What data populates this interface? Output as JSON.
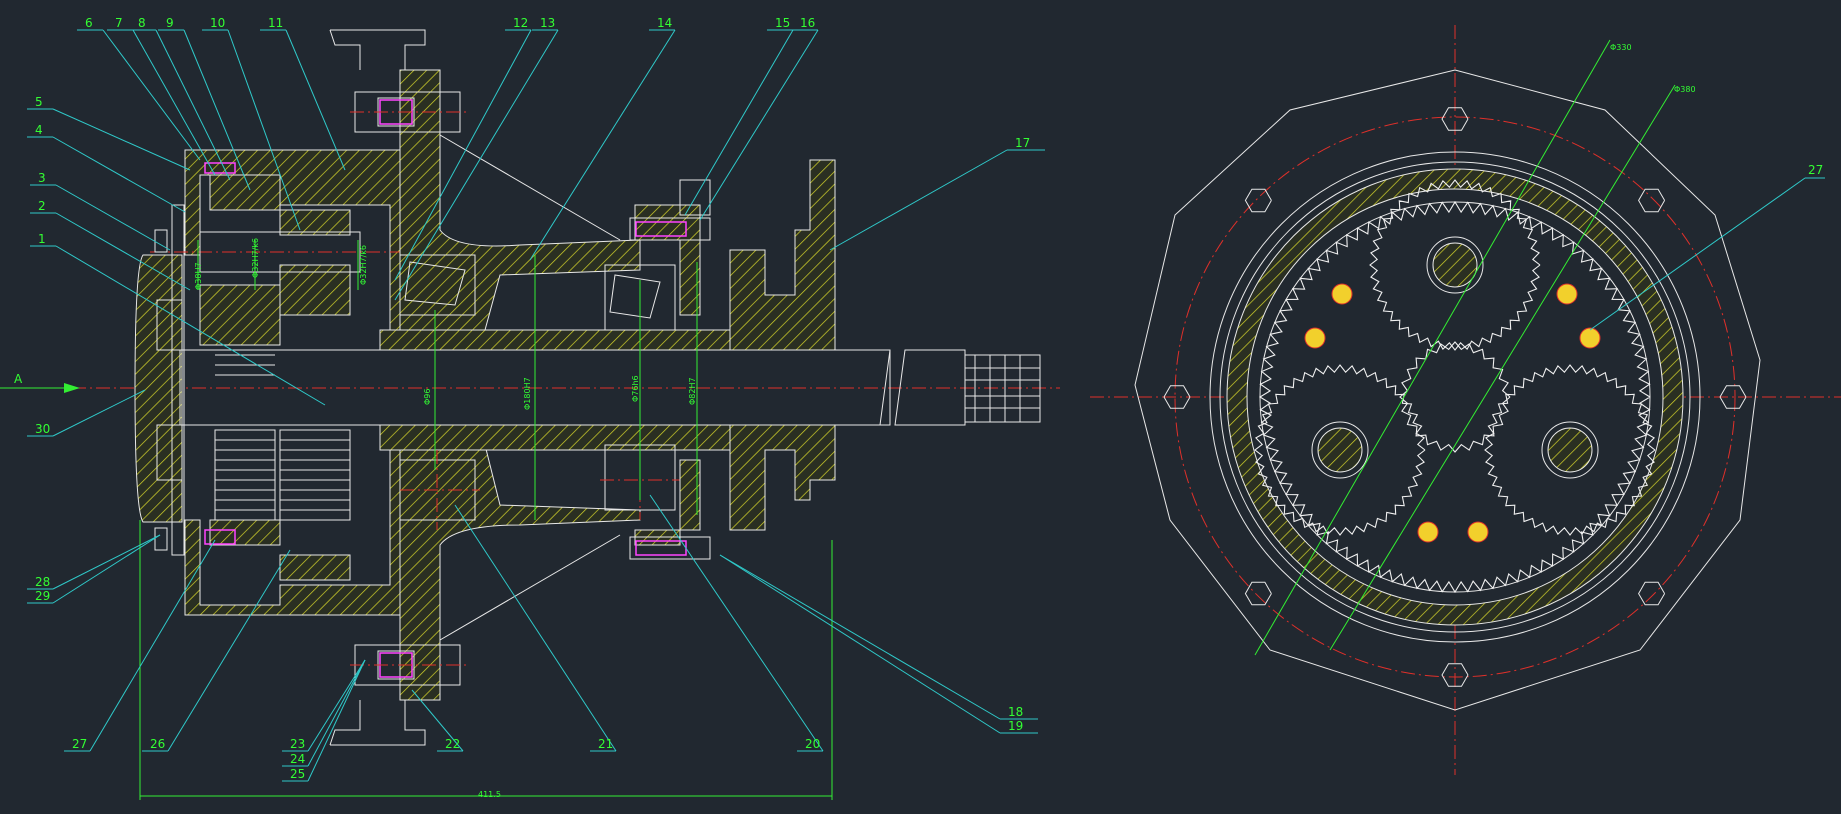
{
  "drawing": {
    "section_marker": "A",
    "dims": {
      "overall_length": "411.5",
      "d1": "Φ330",
      "d2": "Φ380",
      "v1": "Φ96",
      "v2": "Φ180H7",
      "v3": "Φ76h6",
      "v4": "Φ82H7",
      "h1": "Φ38H7",
      "h2": "Φ32H7/k6",
      "h3": "Φ32H7/k6"
    },
    "part_labels_left": [
      "1",
      "2",
      "3",
      "4",
      "5",
      "6",
      "7",
      "8",
      "9",
      "10",
      "11",
      "12",
      "13",
      "14",
      "15",
      "16",
      "17",
      "18",
      "19",
      "20",
      "21",
      "22",
      "23",
      "24",
      "25",
      "26",
      "27",
      "28",
      "29",
      "30"
    ],
    "part_label_right": "27"
  },
  "colors": {
    "background": "#212830",
    "outline": "#e8e8e8",
    "leader": "#2fc9c9",
    "dimension": "#33ee33",
    "centerline": "#e0302a",
    "hatch": "#d6d62a",
    "fastener": "#ff44ff",
    "pin": "#f2d02c"
  }
}
